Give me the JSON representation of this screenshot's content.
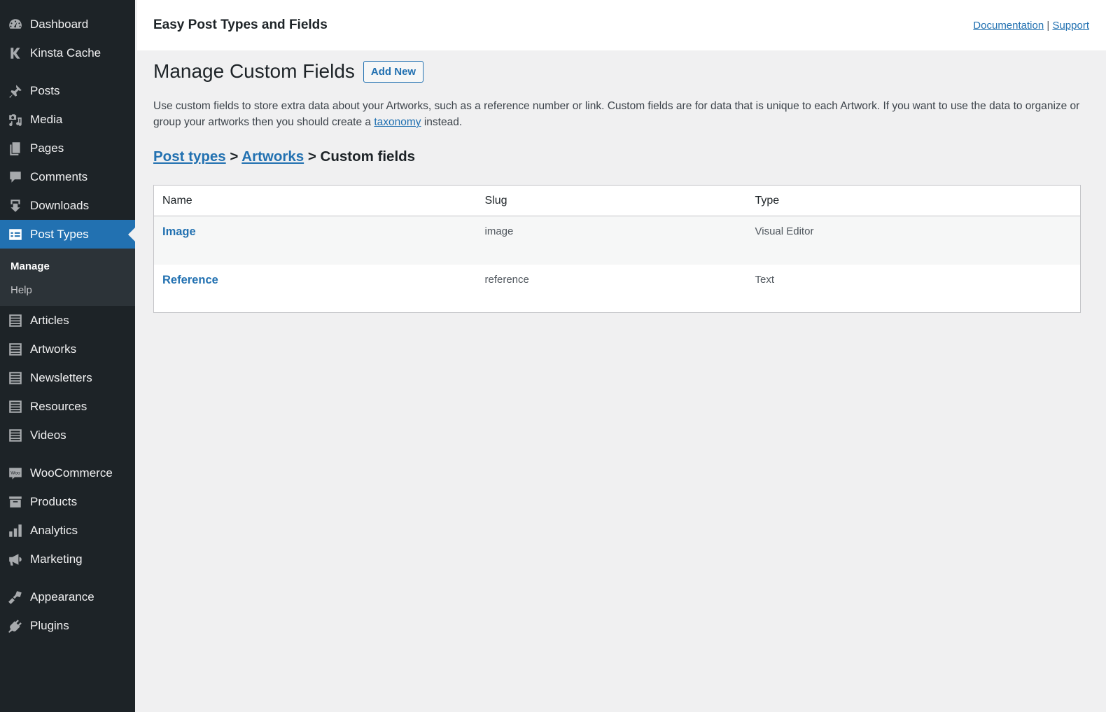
{
  "sidebar": {
    "items": [
      {
        "label": "Dashboard",
        "icon": "dashboard-icon"
      },
      {
        "label": "Kinsta Cache",
        "icon": "kinsta-icon"
      },
      {
        "label": "Posts",
        "icon": "pin-icon"
      },
      {
        "label": "Media",
        "icon": "media-icon"
      },
      {
        "label": "Pages",
        "icon": "pages-icon"
      },
      {
        "label": "Comments",
        "icon": "comment-icon"
      },
      {
        "label": "Downloads",
        "icon": "download-icon"
      },
      {
        "label": "Post Types",
        "icon": "post-types-icon",
        "active": true
      },
      {
        "label": "Articles",
        "icon": "list-icon"
      },
      {
        "label": "Artworks",
        "icon": "list-icon"
      },
      {
        "label": "Newsletters",
        "icon": "list-icon"
      },
      {
        "label": "Resources",
        "icon": "list-icon"
      },
      {
        "label": "Videos",
        "icon": "list-icon"
      },
      {
        "label": "WooCommerce",
        "icon": "woo-icon"
      },
      {
        "label": "Products",
        "icon": "archive-icon"
      },
      {
        "label": "Analytics",
        "icon": "bar-chart-icon"
      },
      {
        "label": "Marketing",
        "icon": "megaphone-icon"
      },
      {
        "label": "Appearance",
        "icon": "paintbrush-icon"
      },
      {
        "label": "Plugins",
        "icon": "plug-icon"
      }
    ],
    "submenu": [
      {
        "label": "Manage",
        "current": true
      },
      {
        "label": "Help"
      }
    ],
    "accent": "#2271b1"
  },
  "header": {
    "title": "Easy Post Types and Fields",
    "documentation": "Documentation",
    "separator": "|",
    "support": "Support"
  },
  "main": {
    "title": "Manage Custom Fields",
    "add_new": "Add New",
    "description_before": "Use custom fields to store extra data about your Artworks, such as a reference number or link. Custom fields are for data that is unique to each Artwork. If you want to use the data to organize or group your artworks then you should create a ",
    "description_link": "taxonomy",
    "description_after": " instead.",
    "breadcrumb": {
      "post_types": "Post types",
      "sep1": " > ",
      "artworks": "Artworks",
      "sep2": " > ",
      "current": "Custom fields"
    },
    "table": {
      "columns": [
        "Name",
        "Slug",
        "Type"
      ],
      "rows": [
        {
          "name": "Image",
          "slug": "image",
          "type": "Visual Editor"
        },
        {
          "name": "Reference",
          "slug": "reference",
          "type": "Text"
        }
      ]
    }
  }
}
